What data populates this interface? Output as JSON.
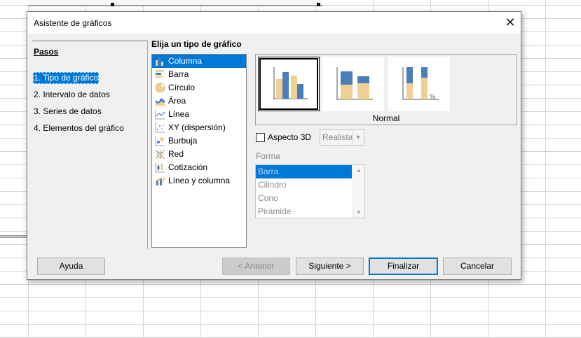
{
  "dialog": {
    "title": "Asistente de gráficos",
    "close_glyph": "✕"
  },
  "steps": {
    "heading": "Pasos",
    "items": [
      {
        "label": "1. Tipo de gráfico",
        "active": true
      },
      {
        "label": "2. Intervalo de datos"
      },
      {
        "label": "3. Series de datos"
      },
      {
        "label": "4. Elementos del gráfico"
      }
    ]
  },
  "chart_type": {
    "heading": "Elija un tipo de gráfico",
    "types": [
      {
        "label": "Columna",
        "icon": "column-chart-icon",
        "selected": true
      },
      {
        "label": "Barra",
        "icon": "bar-chart-icon"
      },
      {
        "label": "Círculo",
        "icon": "pie-chart-icon"
      },
      {
        "label": "Área",
        "icon": "area-chart-icon"
      },
      {
        "label": "Línea",
        "icon": "line-chart-icon"
      },
      {
        "label": "XY (dispersión)",
        "icon": "scatter-chart-icon"
      },
      {
        "label": "Burbuja",
        "icon": "bubble-chart-icon"
      },
      {
        "label": "Red",
        "icon": "net-chart-icon"
      },
      {
        "label": "Cotización",
        "icon": "stock-chart-icon"
      },
      {
        "label": "Línea y columna",
        "icon": "column-line-chart-icon"
      }
    ],
    "variant_label": "Normal",
    "variants": [
      {
        "icon": "normal-column-variant-icon",
        "selected": true
      },
      {
        "icon": "stacked-column-variant-icon"
      },
      {
        "icon": "percent-stacked-column-variant-icon",
        "suffix": "%"
      }
    ]
  },
  "options": {
    "aspect3d_label": "Aspecto 3D",
    "aspect3d_checked": false,
    "aspect3d_combo_value": "Realista",
    "shape_label": "Forma",
    "shapes": [
      "Barra",
      "Cilindro",
      "Cono",
      "Pirámide"
    ]
  },
  "buttons": {
    "help": "Ayuda",
    "back": "< Anterior",
    "next": "Siguiente >",
    "finish": "Finalizar",
    "cancel": "Cancelar"
  },
  "colors": {
    "accent": "#0078d7",
    "chart_blue": "#4a7ebb",
    "chart_tan": "#f0cf93"
  }
}
